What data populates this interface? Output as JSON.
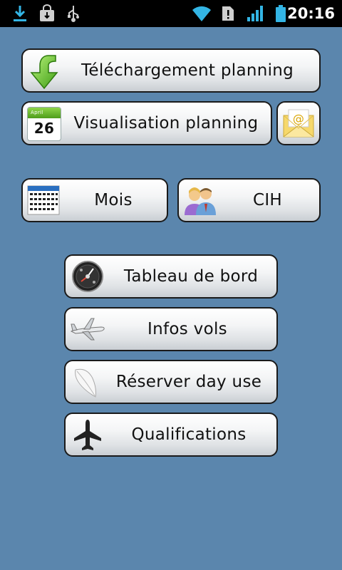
{
  "statusbar": {
    "time": "20:16",
    "icons": [
      "download-icon",
      "store-icon",
      "usb-icon",
      "wifi-icon",
      "alert-icon",
      "signal-icon",
      "battery-icon"
    ]
  },
  "buttons": {
    "telechargement": "Téléchargement planning",
    "visualisation": "Visualisation planning",
    "calendar_day": "26",
    "calendar_month": "April",
    "mois": "Mois",
    "cih": "CIH",
    "tableau": "Tableau de bord",
    "infos": "Infos vols",
    "reserver": "Réserver day use",
    "qualifications": "Qualifications"
  },
  "colors": {
    "background": "#5b86ad",
    "statusbar": "#000000",
    "status_accent": "#33b5e5"
  }
}
